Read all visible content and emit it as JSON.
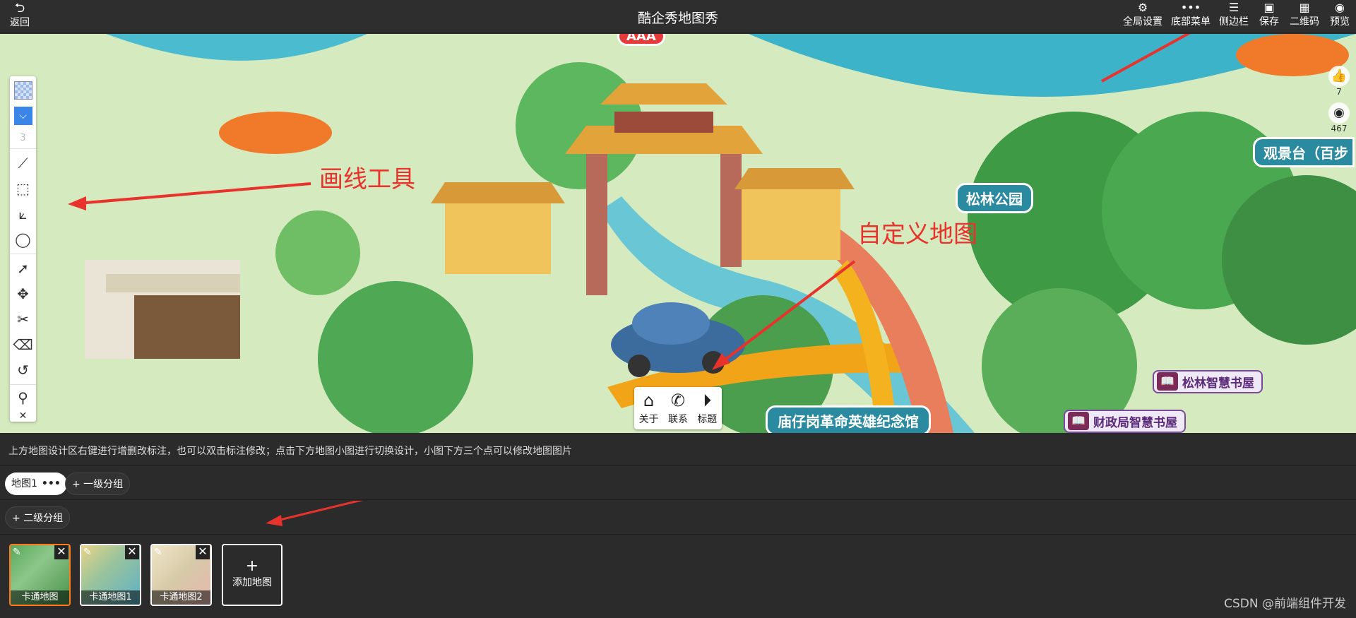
{
  "topbar": {
    "back_label": "返回",
    "title": "酷企秀地图秀",
    "buttons": [
      {
        "label": "全局设置",
        "icon": "gear-icon"
      },
      {
        "label": "底部菜单",
        "icon": "dots-icon"
      },
      {
        "label": "侧边栏",
        "icon": "list-icon"
      },
      {
        "label": "保存",
        "icon": "save-icon"
      },
      {
        "label": "二维码",
        "icon": "qrcode-icon"
      },
      {
        "label": "预览",
        "icon": "eye-icon"
      }
    ]
  },
  "map": {
    "left_toolbar": {
      "counter": "3",
      "tools": [
        "line-tool-icon",
        "rectangle-tool-icon",
        "polyline-tool-icon",
        "circle-tool-icon",
        "select-arrow-icon",
        "move-icon",
        "scissors-icon",
        "eraser-icon",
        "undo-icon",
        "pin-icon",
        "close-icon"
      ]
    },
    "stats": {
      "likes": "7",
      "views": "467"
    },
    "annotations": {
      "draw_tool": "画线工具",
      "custom_map": "自定义地图"
    },
    "places": {
      "pine_park": "松林公园",
      "viewing_platform": "观景台（百步",
      "memorial_hall": "庙仔岗革命英雄纪念馆",
      "pine_library": "松林智慧书屋",
      "finance_library": "财政局智慧书屋",
      "aaa_sign": "AAA"
    },
    "popup": {
      "about": "关于",
      "contact": "联系",
      "title": "标题"
    }
  },
  "hint_text": "上方地图设计区右键进行增删改标注，也可以双击标注修改；点击下方地图小图进行切换设计，小图下方三个点可以修改地图图片",
  "groups": {
    "level1_active": "地图1",
    "level1_dots": "•••",
    "add_level1": "+ 一级分组",
    "add_level2": "+ 二级分组"
  },
  "thumbnails": [
    {
      "name": "卡通地图",
      "active": true,
      "color": "#6aa86a"
    },
    {
      "name": "卡通地图1",
      "active": false,
      "color": "#9cc49a"
    },
    {
      "name": "卡通地图2",
      "active": false,
      "color": "#d6c9a8"
    }
  ],
  "add_map_label": "添加地图",
  "watermark": "CSDN @前端组件开发",
  "colors": {
    "annotation": "#e8322c",
    "active_border": "#ff7a1a",
    "panel_bg": "#2b2b2b"
  }
}
